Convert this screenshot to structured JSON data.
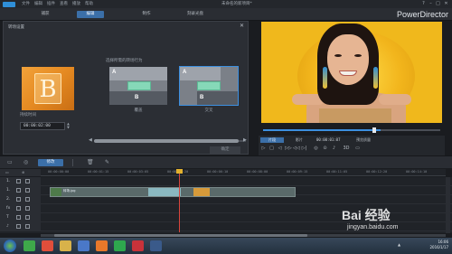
{
  "titlebar": {
    "menu": [
      "文件",
      "编辑",
      "插件",
      "查看",
      "播放",
      "帮助"
    ],
    "app_title": "未命名的新项目*",
    "window_buttons": [
      "?",
      "–",
      "□",
      "✕"
    ]
  },
  "modebar": {
    "tabs": [
      "捕获",
      "编辑",
      "制作",
      "刻录光盘"
    ],
    "active_tab": "编辑",
    "brand": "PowerDirector"
  },
  "transition_panel": {
    "title": "转场设置",
    "close": "✕",
    "duration_label": "持续时间",
    "duration_value": "00:00:02:00",
    "behavior_label": "选择所需的转场行为",
    "options": [
      {
        "label": "覆盖",
        "a": "A",
        "b": "B",
        "selected": false
      },
      {
        "label": "交叉",
        "a": "A",
        "b": "B",
        "selected": true
      }
    ],
    "preview_letter": "B",
    "ok_button": "确定"
  },
  "preview": {
    "tabs": [
      "片段",
      "影片"
    ],
    "active_tab": "片段",
    "timecode": "00:00:01:07",
    "quality": "预览质量",
    "controls": [
      "▷",
      "□",
      "◁",
      "▷▷",
      "◁◁",
      "▷|",
      "◎",
      "⊙",
      "♪",
      "3D",
      "▭"
    ]
  },
  "timeline": {
    "toolbar_button": "修改",
    "ruler_ticks": [
      "00:00:00:00",
      "00:00:01:15",
      "00:00:03:05",
      "00:00:04:20",
      "00:00:06:10",
      "00:00:08:00",
      "00:00:09:15",
      "00:00:11:05",
      "00:00:12:20",
      "00:00:14:10"
    ],
    "tracks": [
      "1.",
      "1.",
      "2.",
      "fx",
      "T",
      "♪"
    ],
    "clip_label": "转场.jpg"
  },
  "taskbar": {
    "time": "16:06",
    "date": "2016/1/17"
  },
  "watermark": {
    "logo": "Bai 经验",
    "url": "jingyan.baidu.com"
  },
  "colors": {
    "accent": "#3b6fa8",
    "selection": "#3c8fe0",
    "playhead": "#d9453c"
  }
}
